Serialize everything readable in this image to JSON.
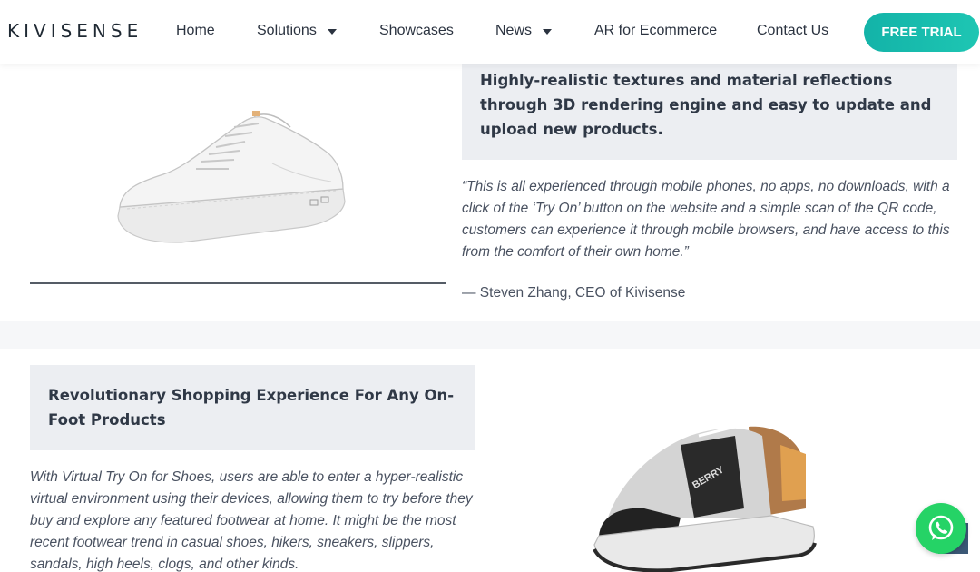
{
  "header": {
    "logo": "KIVISENSE",
    "nav": [
      {
        "label": "Home",
        "has_dropdown": false
      },
      {
        "label": "Solutions",
        "has_dropdown": true
      },
      {
        "label": "Showcases",
        "has_dropdown": false
      },
      {
        "label": "News",
        "has_dropdown": true
      },
      {
        "label": "AR for Ecommerce",
        "has_dropdown": false
      },
      {
        "label": "Contact Us",
        "has_dropdown": false
      }
    ],
    "cta": "FREE TRIAL"
  },
  "section1": {
    "heading": "Highly-realistic textures and material reflections through 3D rendering engine and easy to update and upload new products.",
    "quote": "“This is all experienced through mobile phones, no apps, no downloads, with a click of the ‘Try On’ button on the website and a simple scan of the QR code, customers can experience it through mobile browsers, and have access to this from the comfort of their own home.”",
    "attribution": "— Steven Zhang, CEO of Kivisense",
    "image_icon": "white-sneaker-image"
  },
  "section2": {
    "heading": "Revolutionary Shopping Experience For Any On-Foot Products",
    "body": "With Virtual Try On for Shoes, users are able to enter a hyper-realistic virtual environment using their devices, allowing them to try before they buy and explore any featured footwear at home. It might be the most recent footwear trend in casual shoes, hikers, sneakers, slippers, sandals, high heels, clogs, and other kinds.",
    "image_icon": "burberry-sneaker-image",
    "shoe_text": "BERRY"
  },
  "floating": {
    "whatsapp_icon": "whatsapp-icon",
    "scroll_icon": "scroll-top-icon"
  },
  "colors": {
    "accent": "#1ec6b3",
    "heading_bg": "#eceef2",
    "whatsapp": "#25d366"
  }
}
